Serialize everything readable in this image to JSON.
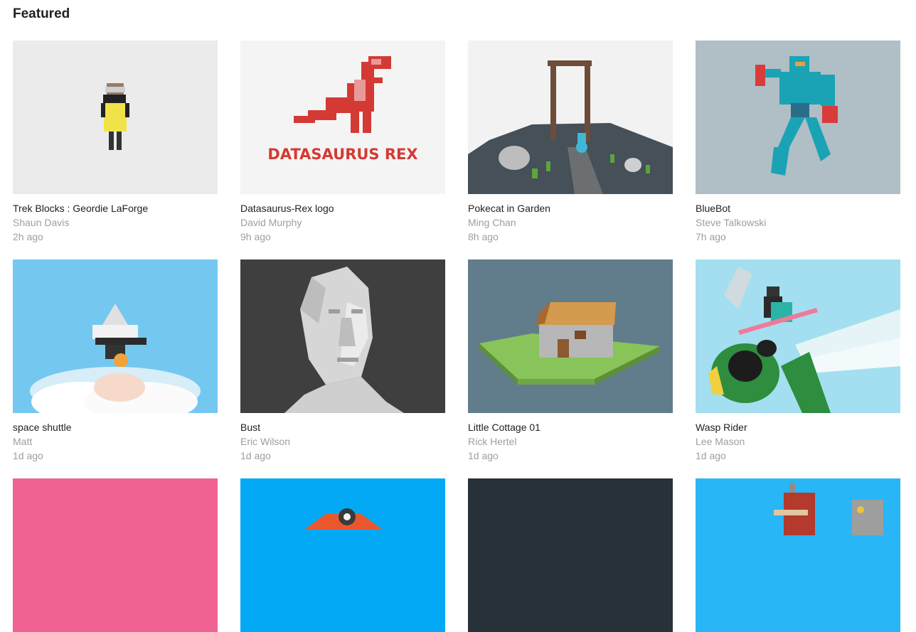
{
  "section": {
    "title": "Featured"
  },
  "cards": [
    {
      "title": "Trek Blocks : Geordie LaForge",
      "author": "Shaun Davis",
      "time": "2h ago",
      "bg": "#ebebeb"
    },
    {
      "title": "Datasaurus-Rex logo",
      "author": "David Murphy",
      "time": "9h ago",
      "bg": "#f4f4f4",
      "logo_text": "DATASAURUS REX"
    },
    {
      "title": "Pokecat in Garden",
      "author": "Ming Chan",
      "time": "8h ago",
      "bg": "#f2f2f2"
    },
    {
      "title": "BlueBot",
      "author": "Steve Talkowski",
      "time": "7h ago",
      "bg": "#b0bec5"
    },
    {
      "title": "space shuttle",
      "author": "Matt",
      "time": "1d ago",
      "bg": "#74c8f0"
    },
    {
      "title": "Bust",
      "author": "Eric Wilson",
      "time": "1d ago",
      "bg": "#3f3f3f"
    },
    {
      "title": "Little Cottage 01",
      "author": "Rick Hertel",
      "time": "1d ago",
      "bg": "#617d8b"
    },
    {
      "title": "Wasp Rider",
      "author": "Lee Mason",
      "time": "1d ago",
      "bg": "#a3dff0"
    },
    {
      "bg": "#f06292"
    },
    {
      "bg": "#03a9f4"
    },
    {
      "bg": "#263238"
    },
    {
      "bg": "#29b6f6"
    }
  ]
}
